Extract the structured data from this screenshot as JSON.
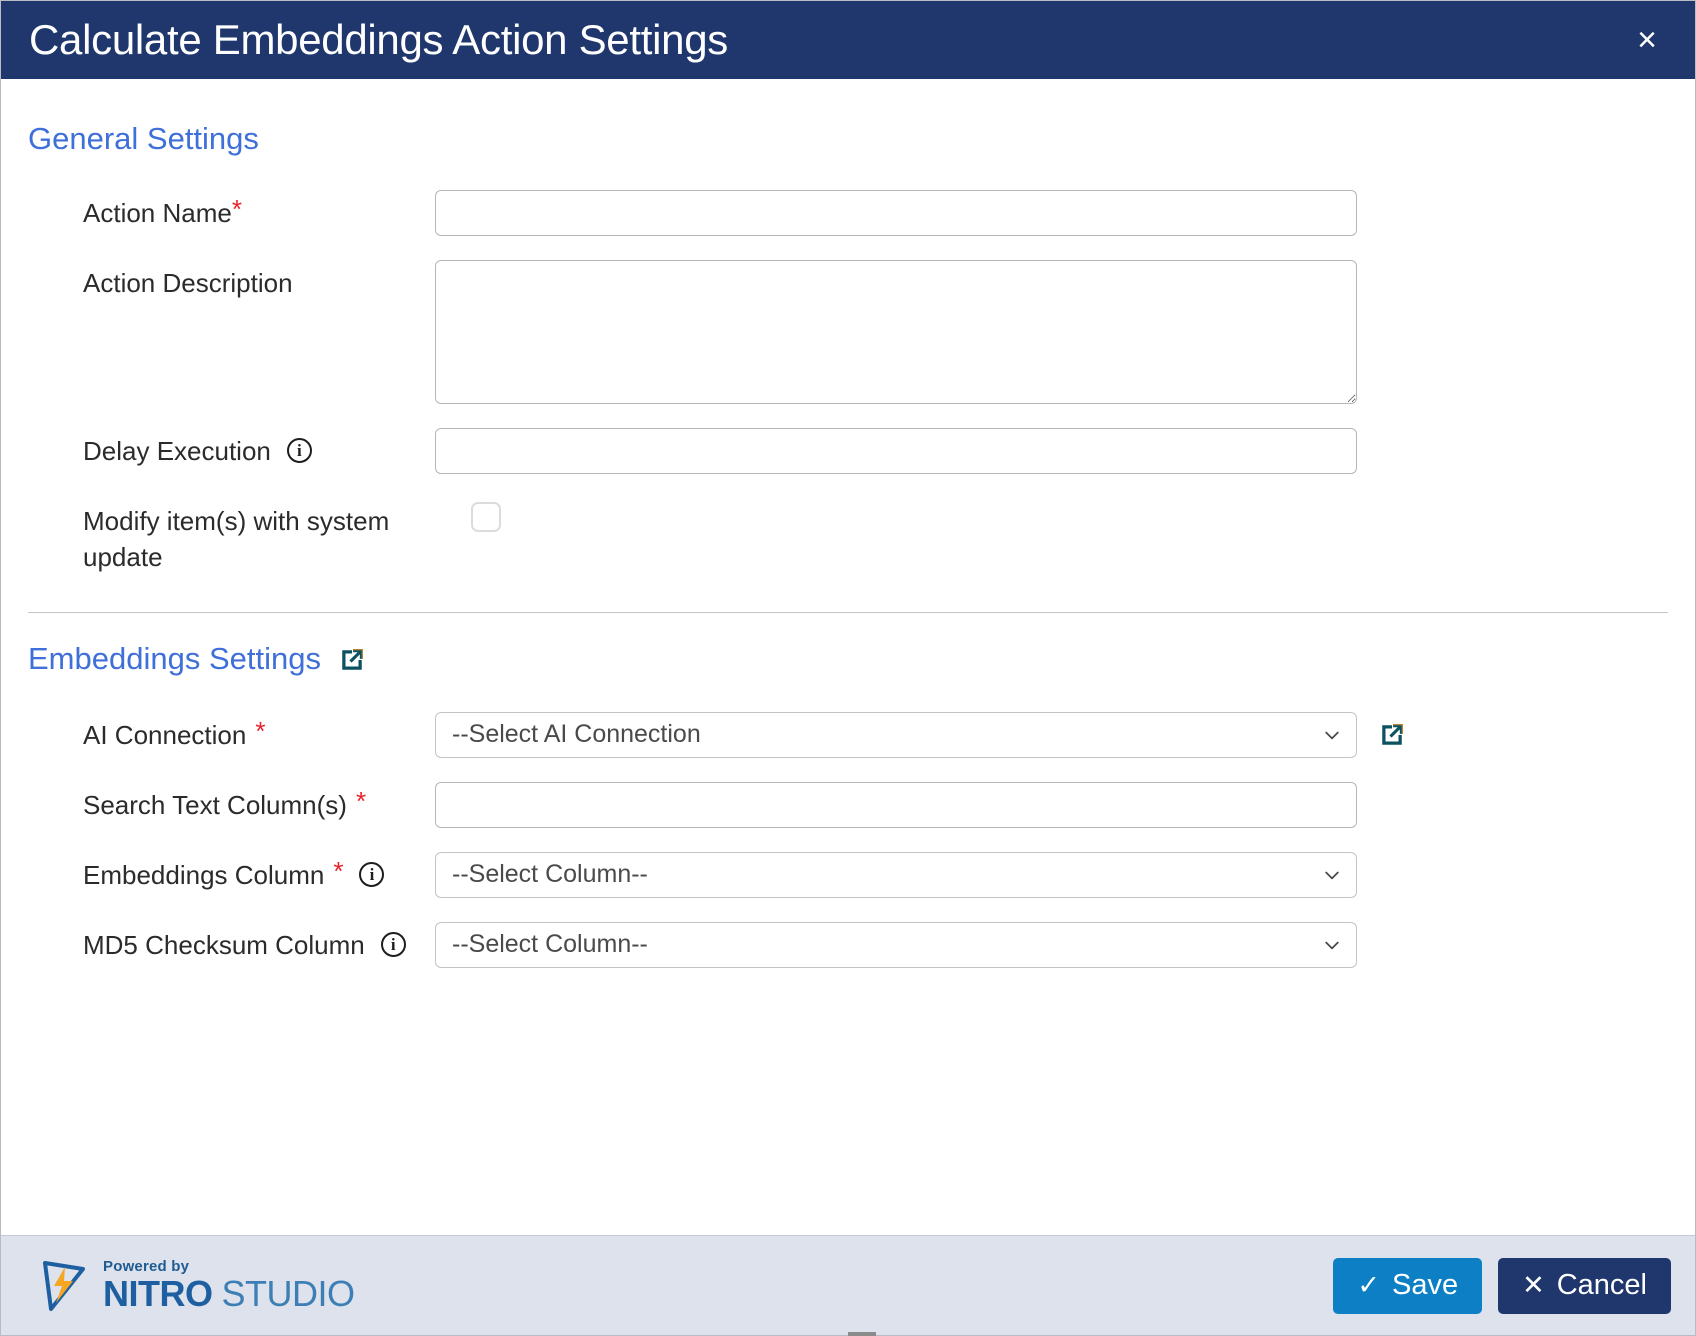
{
  "titlebar": {
    "title": "Calculate Embeddings Action Settings",
    "close_label": "×"
  },
  "general_settings": {
    "heading": "General Settings",
    "fields": {
      "action_name": {
        "label": "Action Name",
        "required_marker": "*",
        "value": "",
        "placeholder": ""
      },
      "action_description": {
        "label": "Action Description",
        "value": "",
        "placeholder": ""
      },
      "delay_execution": {
        "label": "Delay Execution",
        "info_icon": "info-icon",
        "info_glyph": "i",
        "value": "",
        "placeholder": ""
      },
      "modify_with_system_update": {
        "label": "Modify item(s) with system update",
        "checked": false
      }
    }
  },
  "embeddings_settings": {
    "heading": "Embeddings Settings",
    "heading_link_icon": "external-link-icon",
    "fields": {
      "ai_connection": {
        "label": "AI Connection",
        "required_marker": "*",
        "selected": "--Select AI Connection",
        "chevron_icon": "chevron-down-icon",
        "external_link_icon": "external-link-icon"
      },
      "search_text_columns": {
        "label": "Search Text Column(s)",
        "required_marker": "*",
        "value": "",
        "placeholder": ""
      },
      "embeddings_column": {
        "label": "Embeddings Column",
        "required_marker": "*",
        "info_glyph": "i",
        "selected": "--Select Column--",
        "chevron_icon": "chevron-down-icon"
      },
      "md5_checksum_column": {
        "label": "MD5 Checksum Column",
        "info_glyph": "i",
        "selected": "--Select Column--",
        "chevron_icon": "chevron-down-icon"
      }
    }
  },
  "footer": {
    "logo": {
      "powered_by": "Powered by",
      "nitro": "NITRO",
      "studio": "STUDIO"
    },
    "save_label": "Save",
    "save_glyph": "✓",
    "cancel_label": "Cancel",
    "cancel_glyph": "✕"
  },
  "colors": {
    "titlebar_bg": "#20376e",
    "heading_blue": "#3f6fd8",
    "required_red": "#e8222a",
    "save_blue": "#0d7fc4",
    "cancel_navy": "#20376e",
    "footer_bg": "#dde2ec",
    "logo_nitro": "#1d5fa0",
    "logo_studio": "#3d7fb5",
    "logo_bolt": "#f5a623",
    "ext_link_teal": "#0b5261"
  }
}
